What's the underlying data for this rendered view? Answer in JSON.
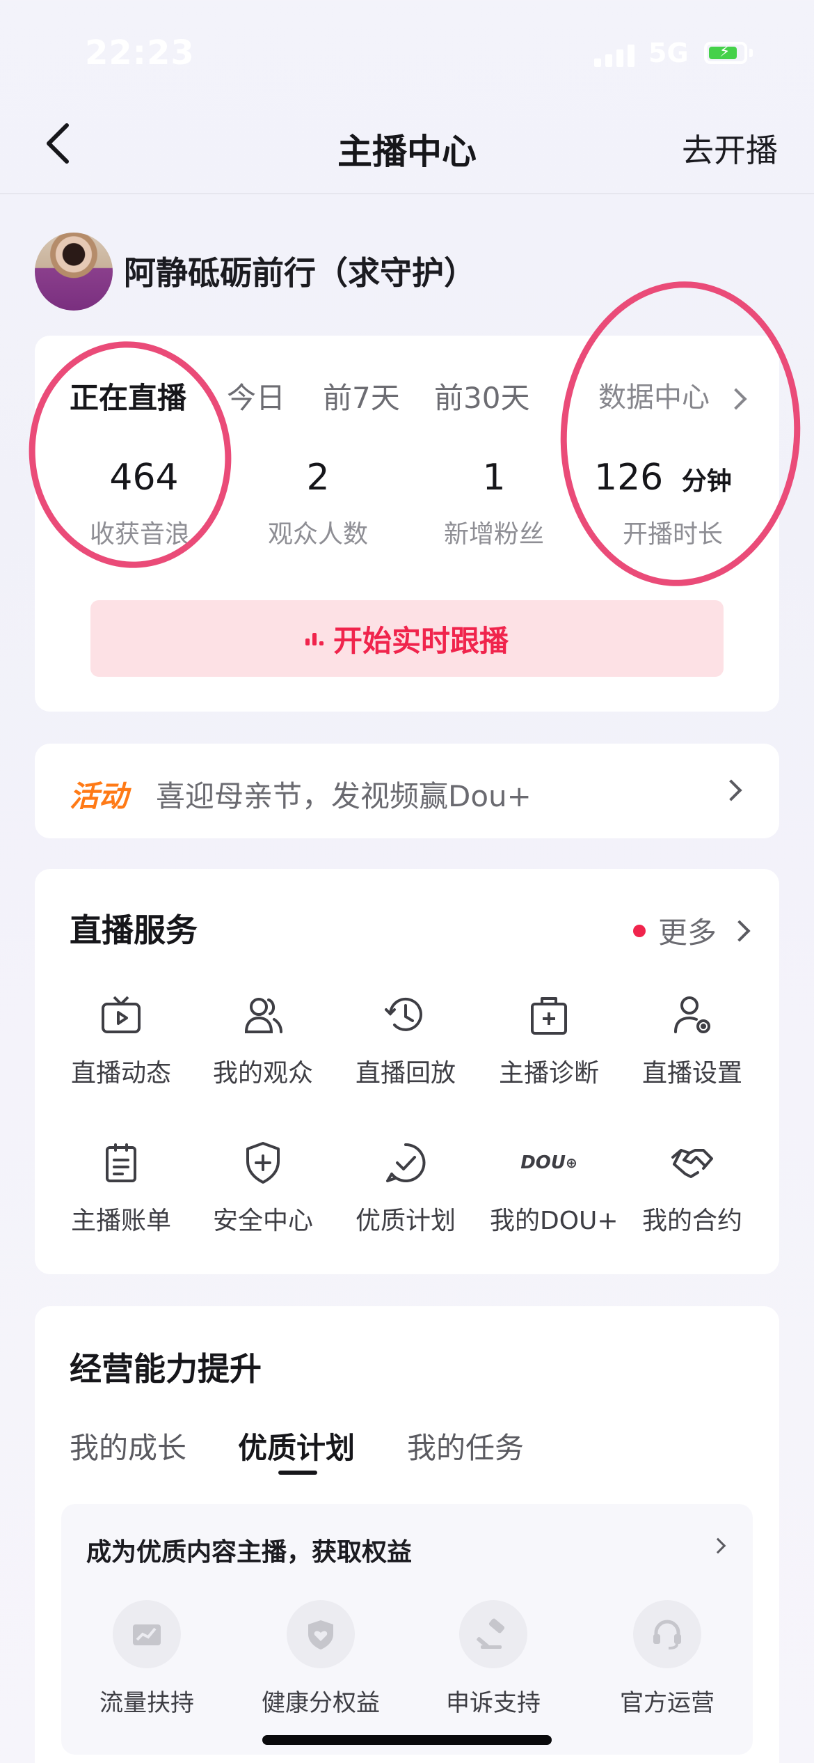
{
  "status_bar": {
    "time": "22:23",
    "network": "5G"
  },
  "nav": {
    "title": "主播中心",
    "action": "去开播"
  },
  "profile": {
    "name": "阿静砥砺前行（求守护）"
  },
  "stats": {
    "tabs": [
      "正在直播",
      "今日",
      "前7天",
      "前30天"
    ],
    "data_center_label": "数据中心",
    "items": [
      {
        "value": "464",
        "unit": "",
        "label": "收获音浪"
      },
      {
        "value": "2",
        "unit": "",
        "label": "观众人数"
      },
      {
        "value": "1",
        "unit": "",
        "label": "新增粉丝"
      },
      {
        "value": "126",
        "unit": "分钟",
        "label": "开播时长"
      }
    ],
    "follow_button": "开始实时跟播"
  },
  "activity": {
    "tag": "活动",
    "text": "喜迎母亲节，发视频赢Dou+"
  },
  "services": {
    "title": "直播服务",
    "more": "更多",
    "items": [
      {
        "label": "直播动态",
        "icon": "tv-play-icon"
      },
      {
        "label": "我的观众",
        "icon": "users-icon"
      },
      {
        "label": "直播回放",
        "icon": "history-clock-icon"
      },
      {
        "label": "主播诊断",
        "icon": "medical-kit-icon"
      },
      {
        "label": "直播设置",
        "icon": "user-settings-icon"
      },
      {
        "label": "主播账单",
        "icon": "clipboard-icon"
      },
      {
        "label": "安全中心",
        "icon": "shield-plus-icon"
      },
      {
        "label": "优质计划",
        "icon": "chat-check-icon"
      },
      {
        "label": "我的DOU+",
        "icon": "dou-plus-icon",
        "icon_text": "DOU"
      },
      {
        "label": "我的合约",
        "icon": "handshake-icon"
      }
    ]
  },
  "growth": {
    "title": "经营能力提升",
    "tabs": [
      "我的成长",
      "优质计划",
      "我的任务"
    ],
    "active_tab": "优质计划",
    "card_title": "成为优质内容主播，获取权益",
    "benefits": [
      {
        "label": "流量扶持",
        "icon": "traffic-chart-icon"
      },
      {
        "label": "健康分权益",
        "icon": "shield-heart-icon"
      },
      {
        "label": "申诉支持",
        "icon": "gavel-icon"
      },
      {
        "label": "官方运营",
        "icon": "headset-icon"
      }
    ]
  }
}
